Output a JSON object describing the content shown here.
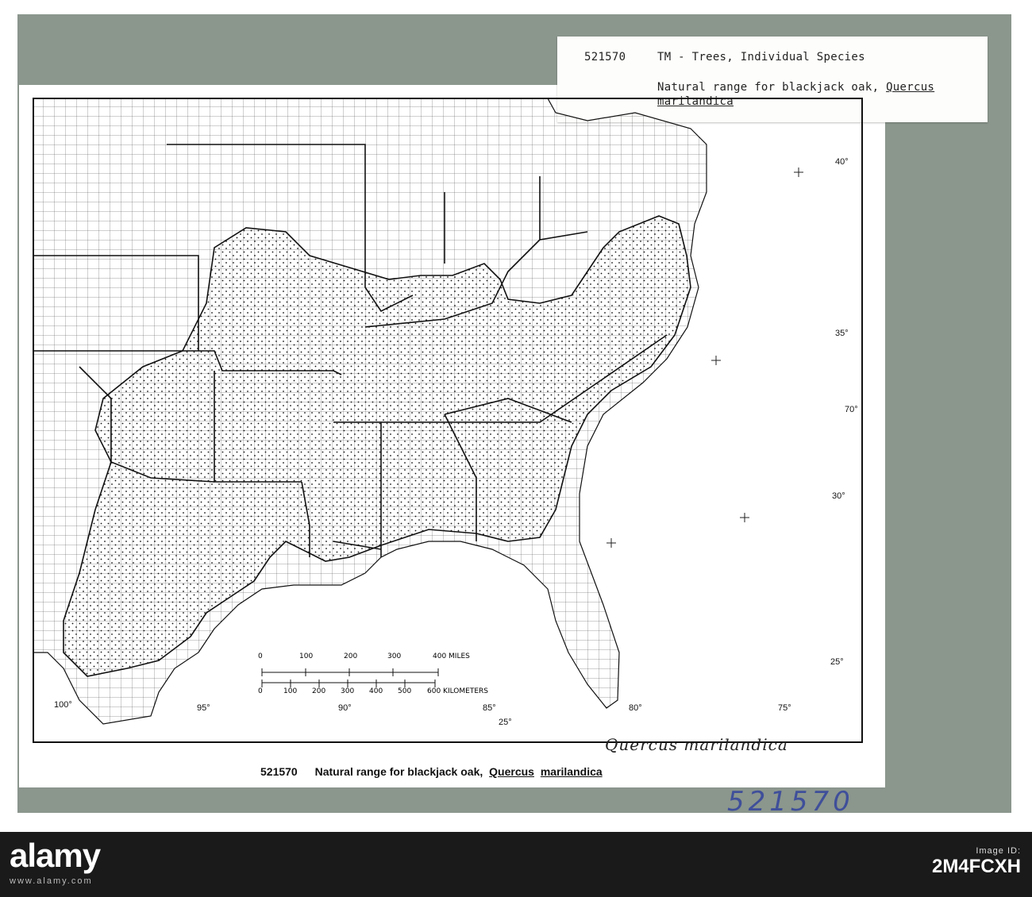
{
  "label_card": {
    "number": "521570",
    "category": "TM - Trees, Individual Species",
    "line1": "Natural range for blackjack oak,",
    "genus": "Quercus",
    "species": "marilandica"
  },
  "map": {
    "latitudes": [
      "40°",
      "35°",
      "30°",
      "25°",
      "25°"
    ],
    "longitudes": [
      "100°",
      "95°",
      "90°",
      "85°",
      "80°",
      "75°",
      "70°"
    ],
    "scale": {
      "miles_ticks": [
        "0",
        "100",
        "200",
        "300",
        "400 MILES"
      ],
      "km_ticks": [
        "0",
        "100",
        "200",
        "300",
        "400",
        "500",
        "600 KILOMETERS"
      ]
    }
  },
  "caption": {
    "number": "521570",
    "text": "Natural range for blackjack oak,",
    "genus": "Quercus",
    "species": "marilandica"
  },
  "handwritten": "Quercus marilandica",
  "stamp_number": "521570",
  "watermark": {
    "brand": "alamy",
    "image_id_label": "Image ID:",
    "image_id": "2M4FCXH",
    "site": "www.alamy.com"
  },
  "colors": {
    "board": "#8b968d",
    "stamp": "#3f4f9a",
    "strip": "#1a1a1a"
  }
}
